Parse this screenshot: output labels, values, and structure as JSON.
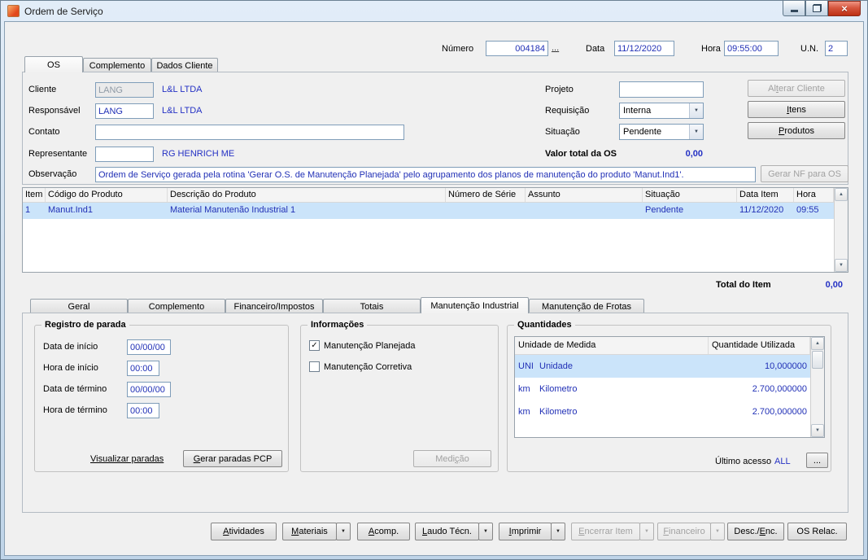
{
  "window": {
    "title": "Ordem de Serviço"
  },
  "header": {
    "numero": {
      "label": "Número",
      "value": "004184",
      "browse": "..."
    },
    "data": {
      "label": "Data",
      "value": "11/12/2020"
    },
    "hora": {
      "label": "Hora",
      "value": "09:55:00"
    },
    "un": {
      "label": "U.N.",
      "value": "2"
    }
  },
  "main_tabs": {
    "os": "OS",
    "complemento": "Complemento",
    "dados_cliente": "Dados Cliente"
  },
  "form": {
    "cliente": {
      "label": "Cliente",
      "value": "LANG",
      "name": "L&L LTDA"
    },
    "responsavel": {
      "label": "Responsável",
      "value": "LANG",
      "name": "L&L LTDA"
    },
    "contato": {
      "label": "Contato",
      "value": ""
    },
    "representante": {
      "label": "Representante",
      "value": "",
      "name": "RG HENRICH ME"
    },
    "observacao": {
      "label": "Observação",
      "value": "Ordem de Serviço gerada pela rotina 'Gerar O.S. de Manutenção Planejada' pelo agrupamento dos planos de manutenção do produto 'Manut.Ind1'."
    },
    "projeto": {
      "label": "Projeto",
      "value": ""
    },
    "requisicao": {
      "label": "Requisição",
      "value": "Interna"
    },
    "situacao": {
      "label": "Situação",
      "value": "Pendente"
    },
    "valor_total": {
      "label": "Valor total da OS",
      "value": "0,00"
    },
    "buttons": {
      "alterar_cliente": "Al&terar Cliente",
      "itens": "&Itens",
      "produtos": "&Produtos",
      "gerar_nf": "Gerar NF para OS"
    }
  },
  "grid": {
    "columns": [
      "Item",
      "Código do Produto",
      "Descrição do Produto",
      "Número de Série",
      "Assunto",
      "Situação",
      "Data Item",
      "Hora"
    ],
    "rows": [
      {
        "item": "1",
        "codigo": "Manut.Ind1",
        "descricao": "Material Manutenão Industrial 1",
        "serie": "",
        "assunto": "",
        "situacao": "Pendente",
        "data": "11/12/2020",
        "hora": "09:55"
      }
    ],
    "total_label": "Total do Item",
    "total_value": "0,00"
  },
  "detail_tabs": {
    "geral": "Geral",
    "complemento": "Complemento",
    "financeiro_impostos": "Financeiro/Impostos",
    "totais": "Totais",
    "manutencao_industrial": "Manutenção Industrial",
    "manutencao_frotas": "Manutenção de Frotas"
  },
  "registro_parada": {
    "title": "Registro de parada",
    "data_inicio": {
      "label": "Data de início",
      "value": "00/00/00"
    },
    "hora_inicio": {
      "label": "Hora de início",
      "value": "00:00"
    },
    "data_termino": {
      "label": "Data de término",
      "value": "00/00/00"
    },
    "hora_termino": {
      "label": "Hora de término",
      "value": "00:00"
    },
    "visualizar_link": "Visualizar paradas",
    "gerar_button": "&Gerar paradas PCP"
  },
  "informacoes": {
    "title": "Informações",
    "planejada": {
      "label": "Manutenção Planejada",
      "checked": "✓"
    },
    "corretiva": {
      "label": "Manutenção Corretiva",
      "checked": ""
    },
    "medicao_button": "Medi&ção"
  },
  "quantidades": {
    "title": "Quantidades",
    "columns": [
      "Unidade de Medida",
      "Quantidade Utilizada"
    ],
    "rows": [
      {
        "sigla": "UNI",
        "nome": "Unidade",
        "qtd": "10,000000"
      },
      {
        "sigla": "km",
        "nome": "Kilometro",
        "qtd": "2.700,000000"
      },
      {
        "sigla": "km",
        "nome": "Kilometro",
        "qtd": "2.700,000000"
      }
    ],
    "ultimo_acesso_label": "Último acesso",
    "ultimo_acesso_value": "ALL",
    "browse": "..."
  },
  "actions": {
    "atividades": "&Atividades",
    "materiais": "&Materiais",
    "acomp": "&Acomp.",
    "laudo_tecn": "&Laudo Técn.",
    "imprimir": "&Imprimir",
    "encerrar_item": "&Encerrar Item",
    "financeiro": "&Financeiro",
    "desc_enc": "Desc./&Enc.",
    "os_relac": "OS Relac."
  },
  "colors": {
    "accent_blue": "#2431c4",
    "selection": "#cbe4fa",
    "close_red": "#bd3014"
  }
}
